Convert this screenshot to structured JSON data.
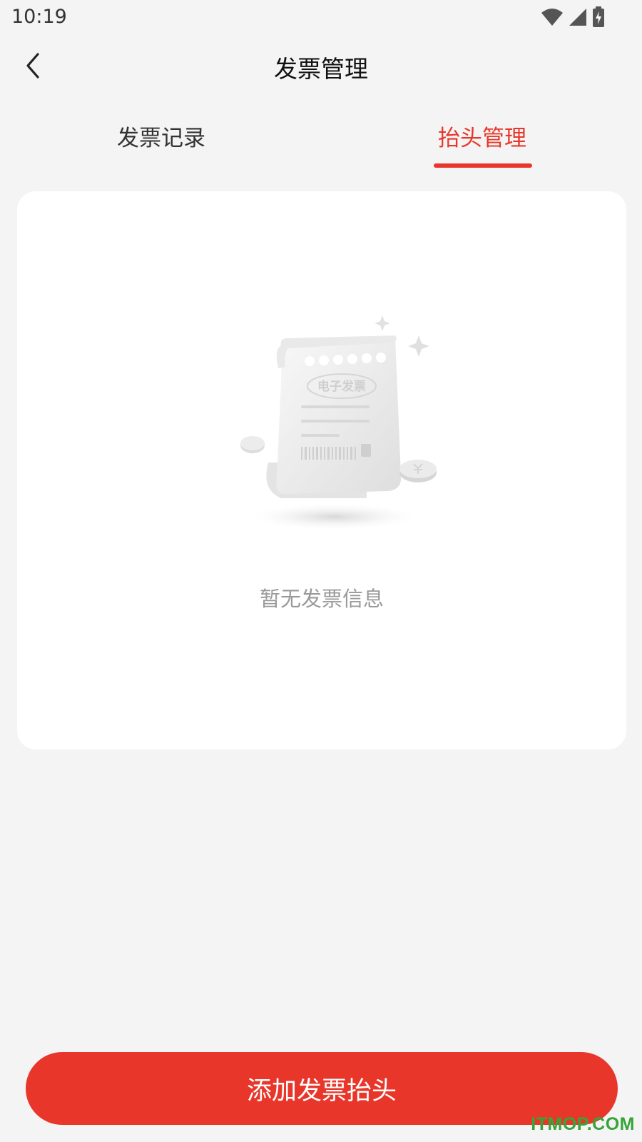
{
  "status_bar": {
    "time": "10:19",
    "icons": [
      "wifi-icon",
      "signal-icon",
      "battery-charging-icon"
    ]
  },
  "header": {
    "title": "发票管理",
    "back_icon": "chevron-left-icon"
  },
  "tabs": [
    {
      "label": "发票记录",
      "active": false
    },
    {
      "label": "抬头管理",
      "active": true
    }
  ],
  "empty_state": {
    "illustration": "e-invoice-receipt-illustration",
    "illustration_text": "电子发票",
    "message": "暂无发票信息"
  },
  "actions": {
    "add_button_label": "添加发票抬头"
  },
  "watermark": "ITMOP.COM",
  "colors": {
    "accent": "#e8372a",
    "background": "#f4f4f4",
    "card": "#ffffff",
    "muted_text": "#999999"
  }
}
